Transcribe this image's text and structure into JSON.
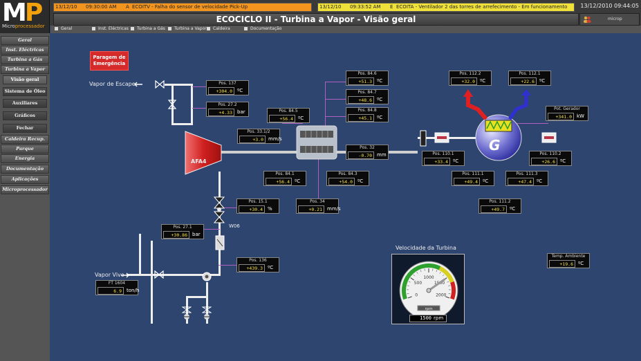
{
  "logo": {
    "letters_m": "M",
    "letters_p": "P",
    "sub_a": "Micro",
    "sub_b": "processador"
  },
  "alarms": [
    {
      "date": "13/12/10",
      "time": "09:30:00 AM",
      "state": "A",
      "text": "ECOITV - Falha do sensor de velocidade Pick-Up",
      "color": "#f2941e"
    },
    {
      "date": "13/12/10",
      "time": "09:33:52 AM",
      "state": "E",
      "text": "ECOITA - Ventilador 2 das torres de arrefecimento - Em funcionamento",
      "color": "#f0e03a"
    }
  ],
  "clock": "13/12/2010 09:44:05",
  "title": "ECOCICLO II - Turbina a Vapor - Visão geral",
  "user": "microp",
  "tabs": [
    "Geral",
    "Inst. Eléctricas",
    "Turbina a Gás",
    "Turbina a Vapor",
    "Caldeira",
    "Documentação"
  ],
  "sidebar": [
    {
      "label": "Geral",
      "sub": false
    },
    {
      "label": "Inst. Eléctricas",
      "sub": false
    },
    {
      "label": "Turbina a Gás",
      "sub": false
    },
    {
      "label": "Turbina a Vapor",
      "sub": false
    },
    {
      "label": "Visão geral",
      "sub": true
    },
    {
      "label": "Sistema de Óleo",
      "sub": true
    },
    {
      "label": "Auxiliares",
      "sub": true
    },
    {
      "label": "Gráficos",
      "sub": true
    },
    {
      "label": "Fechar",
      "sub": true
    },
    {
      "label": "Caldeira Recup.",
      "sub": false
    },
    {
      "label": "Parque",
      "sub": false
    },
    {
      "label": "Energia",
      "sub": false
    },
    {
      "label": "Documentação",
      "sub": false
    },
    {
      "label": "Aplicações",
      "sub": false
    },
    {
      "label": "Microprocessador",
      "sub": false
    }
  ],
  "emergency": "Paragem de Emergência",
  "labels": {
    "exhaust": "Vapor de Escape",
    "live_steam": "Vapor Vivo",
    "turbine": "AFA4",
    "generator": "G",
    "valve_tag": "W06"
  },
  "measurements": [
    {
      "tag": "Pos. 137",
      "value": "+304.0",
      "unit": "ºC"
    },
    {
      "tag": "Pos. 27.2",
      "value": "+4.33",
      "unit": "bar"
    },
    {
      "tag": "Pos. 84.5",
      "value": "+56.4",
      "unit": "ºC"
    },
    {
      "tag": "Pos. 33.1/2",
      "value": "+3.0",
      "unit": "mm/s"
    },
    {
      "tag": "Pos. 84.6",
      "value": "+51.3",
      "unit": "ºC"
    },
    {
      "tag": "Pos. 84.7",
      "value": "+48.6",
      "unit": "ºC"
    },
    {
      "tag": "Pos. 84.8",
      "value": "+45.1",
      "unit": "ºC"
    },
    {
      "tag": "Pos. 32",
      "value": "-0.70",
      "unit": "mm"
    },
    {
      "tag": "Pos. 84.1",
      "value": "+56.4",
      "unit": "ºC"
    },
    {
      "tag": "Pos. 84.3",
      "value": "+54.0",
      "unit": "ºC"
    },
    {
      "tag": "Pos. 34",
      "value": "+0.21",
      "unit": "mm/s"
    },
    {
      "tag": "Pos. 112.2",
      "value": "+32.0",
      "unit": "ºC"
    },
    {
      "tag": "Pos. 112.1",
      "value": "+22.6",
      "unit": "ºC"
    },
    {
      "tag": "Pot. Gerador",
      "value": "+341.0",
      "unit": "kW"
    },
    {
      "tag": "Pos. 110.1",
      "value": "+33.4",
      "unit": "ºC"
    },
    {
      "tag": "Pos. 110.2",
      "value": "+26.6",
      "unit": "ºC"
    },
    {
      "tag": "Pos. 111.1",
      "value": "+49.4",
      "unit": "ºC"
    },
    {
      "tag": "Pos. 111.3",
      "value": "+47.4",
      "unit": "ºC"
    },
    {
      "tag": "Pos. 111.2",
      "value": "+49.7",
      "unit": "ºC"
    },
    {
      "tag": "Pos. 15.1",
      "value": "+30.4",
      "unit": "%"
    },
    {
      "tag": "Pos. 27.1",
      "value": "+30.86",
      "unit": "bar"
    },
    {
      "tag": "Pos. 136",
      "value": "+439.3",
      "unit": "ºC"
    },
    {
      "tag": "FT 1604",
      "value": "6.9",
      "unit": "ton/h"
    },
    {
      "tag": "Temp. Ambiente",
      "value": "+19.6",
      "unit": "ºC"
    }
  ],
  "gauge": {
    "title": "Velocidade da Turbina",
    "ticks": [
      "0",
      "500",
      "1000",
      "1500",
      "2000"
    ],
    "unit": "rpm",
    "value": 1500,
    "readout": "1500",
    "readout_unit": "rpm",
    "zone_colors": [
      "#2ea02e",
      "#d8d020",
      "#d02020"
    ]
  },
  "colors": {
    "background": "#2e4570",
    "pipe": "#eeeeee",
    "signal": "#b060c0",
    "value": "#f5e04a",
    "emergency": "#d42a2a"
  }
}
